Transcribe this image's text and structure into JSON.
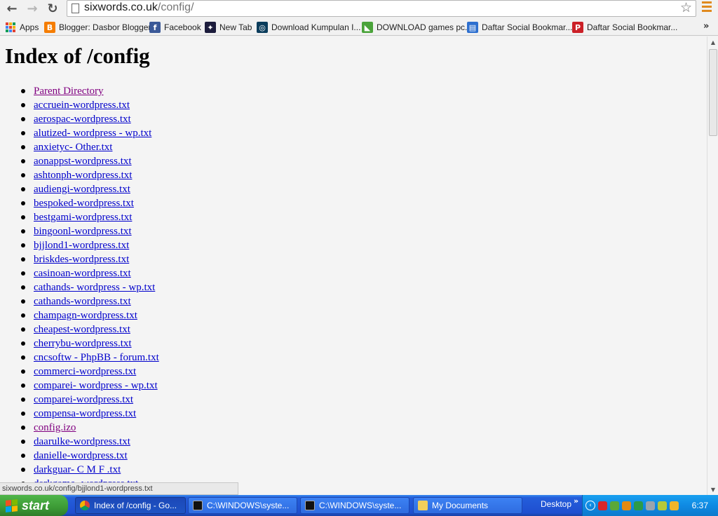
{
  "browser": {
    "url_host": "sixwords.co.uk",
    "url_path": "/config/",
    "back_glyph": "←",
    "forward_glyph": "→",
    "reload_glyph": "↻",
    "star_glyph": "☆"
  },
  "bookmarks": [
    {
      "label": "Apps",
      "icon": "apps-grid-icon",
      "color": "#3b78e7"
    },
    {
      "label": "Blogger: Dasbor Blogger",
      "icon": "blogger-icon",
      "color": "#f57d00",
      "glyph": "B"
    },
    {
      "label": "Facebook",
      "icon": "facebook-icon",
      "color": "#3b5998",
      "glyph": "f"
    },
    {
      "label": "New Tab",
      "icon": "new-tab-icon",
      "color": "#1c1c3c",
      "glyph": "✦"
    },
    {
      "label": "Download Kumpulan I...",
      "icon": "download-site-icon",
      "color": "#0b3d5c",
      "glyph": "◎"
    },
    {
      "label": "DOWNLOAD games pc...",
      "icon": "games-site-icon",
      "color": "#4aa33a",
      "glyph": "◣"
    },
    {
      "label": "Daftar Social Bookmar...",
      "icon": "bookmark-site-icon",
      "color": "#2d6fcf",
      "glyph": "▤"
    },
    {
      "label": "Daftar Social Bookmar...",
      "icon": "pinterest-icon",
      "color": "#cb2027",
      "glyph": "P"
    }
  ],
  "bookmarks_overflow": "»",
  "page": {
    "title": "Index of /config",
    "entries": [
      {
        "label": "Parent Directory",
        "visited": true
      },
      {
        "label": "accruein-wordpress.txt",
        "visited": false
      },
      {
        "label": "aerospac-wordpress.txt",
        "visited": false
      },
      {
        "label": "alutized- wordpress - wp.txt",
        "visited": false
      },
      {
        "label": "anxietyc- Other.txt",
        "visited": false
      },
      {
        "label": "aonappst-wordpress.txt",
        "visited": false
      },
      {
        "label": "ashtonph-wordpress.txt",
        "visited": false
      },
      {
        "label": "audiengi-wordpress.txt",
        "visited": false
      },
      {
        "label": "bespoked-wordpress.txt",
        "visited": false
      },
      {
        "label": "bestgami-wordpress.txt",
        "visited": false
      },
      {
        "label": "bingoonl-wordpress.txt",
        "visited": false
      },
      {
        "label": "bjjlond1-wordpress.txt",
        "visited": false
      },
      {
        "label": "briskdes-wordpress.txt",
        "visited": false
      },
      {
        "label": "casinoan-wordpress.txt",
        "visited": false
      },
      {
        "label": "cathands- wordpress - wp.txt",
        "visited": false
      },
      {
        "label": "cathands-wordpress.txt",
        "visited": false
      },
      {
        "label": "champagn-wordpress.txt",
        "visited": false
      },
      {
        "label": "cheapest-wordpress.txt",
        "visited": false
      },
      {
        "label": "cherrybu-wordpress.txt",
        "visited": false
      },
      {
        "label": "cncsoftw - PhpBB - forum.txt",
        "visited": false
      },
      {
        "label": "commerci-wordpress.txt",
        "visited": false
      },
      {
        "label": "comparei- wordpress - wp.txt",
        "visited": false
      },
      {
        "label": "comparei-wordpress.txt",
        "visited": false
      },
      {
        "label": "compensa-wordpress.txt",
        "visited": false
      },
      {
        "label": "config.izo",
        "visited": true
      },
      {
        "label": "daarulke-wordpress.txt",
        "visited": false
      },
      {
        "label": "danielle-wordpress.txt",
        "visited": false
      },
      {
        "label": "darkguar- C M F .txt",
        "visited": false
      },
      {
        "label": "darkgame- wordpress.txt",
        "visited": false
      }
    ]
  },
  "status_url": "sixwords.co.uk/config/bjjlond1-wordpress.txt",
  "taskbar": {
    "start_label": "start",
    "tasks": [
      {
        "label": "Index of /config - Go...",
        "icon": "chrome-icon",
        "color": "#e8c23a",
        "active": true
      },
      {
        "label": "C:\\WINDOWS\\syste...",
        "icon": "cmd-icon",
        "color": "#111111",
        "active": false
      },
      {
        "label": "C:\\WINDOWS\\syste...",
        "icon": "cmd-icon",
        "color": "#111111",
        "active": false
      },
      {
        "label": "My Documents",
        "icon": "folder-icon",
        "color": "#f2cf5b",
        "active": false
      }
    ],
    "desktop_label": "Desktop",
    "desktop_chevron": "»",
    "tray_icons": [
      {
        "icon": "tray-flash-icon",
        "color": "#d8262b"
      },
      {
        "icon": "tray-network-icon",
        "color": "#5aa83a"
      },
      {
        "icon": "tray-av-icon",
        "color": "#e38a14"
      },
      {
        "icon": "tray-globe-icon",
        "color": "#2c9b49"
      },
      {
        "icon": "tray-volume-icon",
        "color": "#9aa4ad"
      },
      {
        "icon": "tray-shield-icon",
        "color": "#b7c93a"
      },
      {
        "icon": "tray-pencil-icon",
        "color": "#f0b52a"
      }
    ],
    "clock": "6:37"
  }
}
